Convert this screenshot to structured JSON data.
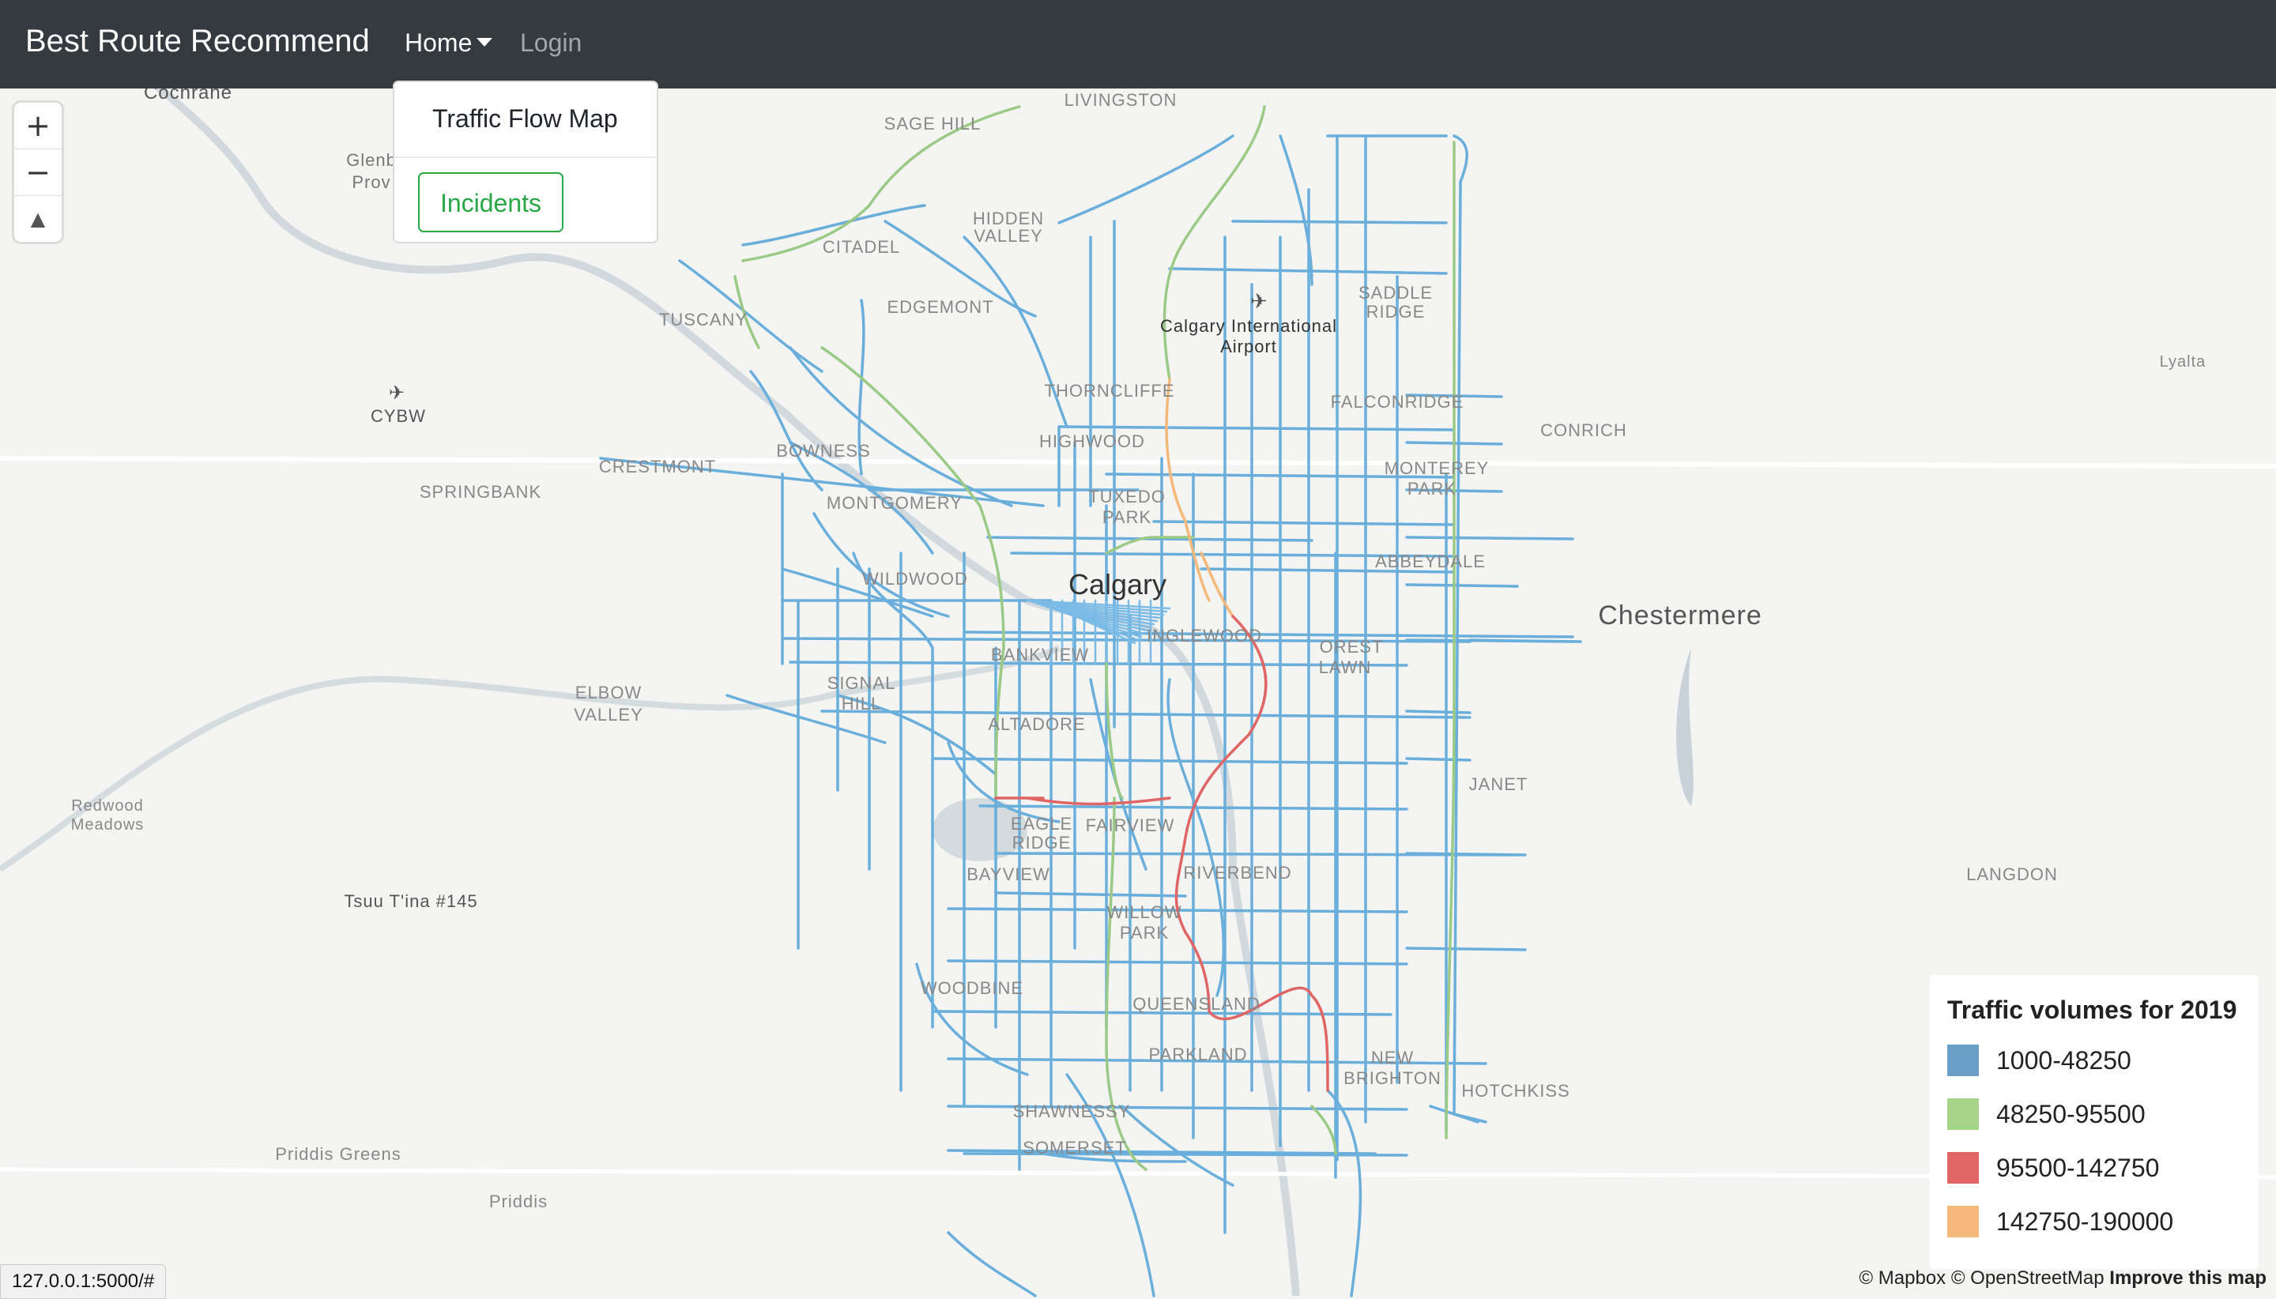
{
  "navbar": {
    "brand": "Best Route Recommend",
    "home_label": "Home",
    "login_label": "Login"
  },
  "dropdown": {
    "traffic_flow": "Traffic Flow Map",
    "incidents": "Incidents"
  },
  "map": {
    "city_label": "Calgary",
    "zoom_in": "+",
    "zoom_out": "−",
    "compass": "▲",
    "places": [
      "Cochrane",
      "LIVINGSTON",
      "SAGE HILL",
      "HIDDEN VALLEY",
      "CITADEL",
      "EDGEMONT",
      "TUSCANY",
      "Calgary International Airport",
      "SADDLE RIDGE",
      "FALCONRIDGE",
      "THORNCLIFFE",
      "HIGHWOOD",
      "BOWNESS",
      "CRESTMONT",
      "SPRINGBANK",
      "CYBW",
      "MONTGOMERY",
      "TUXEDO PARK",
      "MONTEREY PARK",
      "ABBEYDALE",
      "CONRICH",
      "Chestermere",
      "WILDWOOD",
      "INGLEWOOD",
      "FOREST LAWN",
      "BANKVIEW",
      "SIGNAL HILL",
      "ELBOW VALLEY",
      "ALTADORE",
      "Redwood Meadows",
      "JANET",
      "EAGLE RIDGE",
      "FAIRVIEW",
      "BAYVIEW",
      "RIVERBEND",
      "Tsuu T'ina #145",
      "WILLOW PARK",
      "WOODBINE",
      "QUEENSLAND",
      "PARKLAND",
      "NEW BRIGHTON",
      "HOTCHKISS",
      "SHAWNESSY",
      "SOMERSET",
      "Priddis Greens",
      "Priddis",
      "LANGDON",
      "Lyalta",
      "Glenbow Provincial"
    ]
  },
  "legend": {
    "title": "Traffic volumes for 2019",
    "items": [
      {
        "label": "1000-48250",
        "color": "#6a9fc7"
      },
      {
        "label": "48250-95500",
        "color": "#a6d489"
      },
      {
        "label": "95500-142750",
        "color": "#e06666"
      },
      {
        "label": "142750-190000",
        "color": "#f4b97a"
      }
    ]
  },
  "status_url": "127.0.0.1:5000/#",
  "attribution": {
    "mapbox": "© Mapbox",
    "osm": "© OpenStreetMap",
    "improve": "Improve this map"
  },
  "colors": {
    "road_blue": "#6aaedb",
    "road_green": "#9bca86",
    "road_red": "#e06666",
    "road_orange": "#f4b97a",
    "navbar": "#343a40",
    "accent_green": "#28a745"
  }
}
